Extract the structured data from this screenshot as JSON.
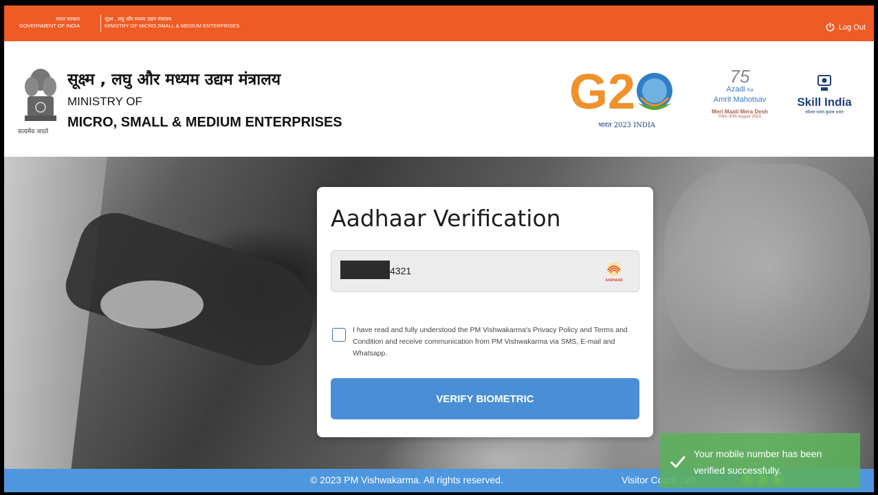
{
  "topbar": {
    "gov_hindi": "भारत सरकार",
    "gov_english": "GOVERNMENT OF INDIA",
    "ministry_hindi_small": "सूक्ष्म , लघु और मध्यम उद्यम मंत्रालय",
    "ministry_english_small": "MINISTRY OF MICRO,SMALL & MEDIUM ENTERPRISES",
    "logout_label": "Log Out",
    "logout_icon": "power-icon"
  },
  "header": {
    "emblem_caption": "सत्यमेव जयते",
    "ministry_hindi": "सूक्ष्म , लघु और मध्यम उद्यम मंत्रालय",
    "ministry_of": "MINISTRY OF",
    "ministry_name": "MICRO, SMALL & MEDIUM ENTERPRISES",
    "g20_text": "G20",
    "g20_caption": "भारत 2023 INDIA",
    "amrit_75": "75",
    "amrit_line1": "Azadi",
    "amrit_ka": "Ka",
    "amrit_line2": "Amrit Mahotsav",
    "amrit_line3": "Meri Maati Mera Desh",
    "amrit_dates": "09th–30th August 2023",
    "skill_title": "Skill India",
    "skill_caption": "कौशल भारत-कुशल भारत"
  },
  "form": {
    "title": "Aadhaar Verification",
    "aadhaar_value": "4321",
    "aadhaar_logo_text": "AADHAAR",
    "consent_text": "I have read and fully understood the PM Vishwakarma's Privacy Policy and Terms and Condition and receive communication from PM Vishwakarma via SMS, E-mail and Whatsapp.",
    "verify_button": "VERIFY BIOMETRIC"
  },
  "footer": {
    "copyright": "© 2023 PM Vishwakarma. All rights reserved.",
    "visitor_count": "Visitor Count : 20",
    "social": [
      "f",
      "X",
      "▶"
    ]
  },
  "toast": {
    "message": "Your mobile number has been verified successfully."
  },
  "colors": {
    "topbar": "#ee5b24",
    "button": "#4a8fd6",
    "footer": "#4e97de",
    "toast": "#5cb05c"
  }
}
